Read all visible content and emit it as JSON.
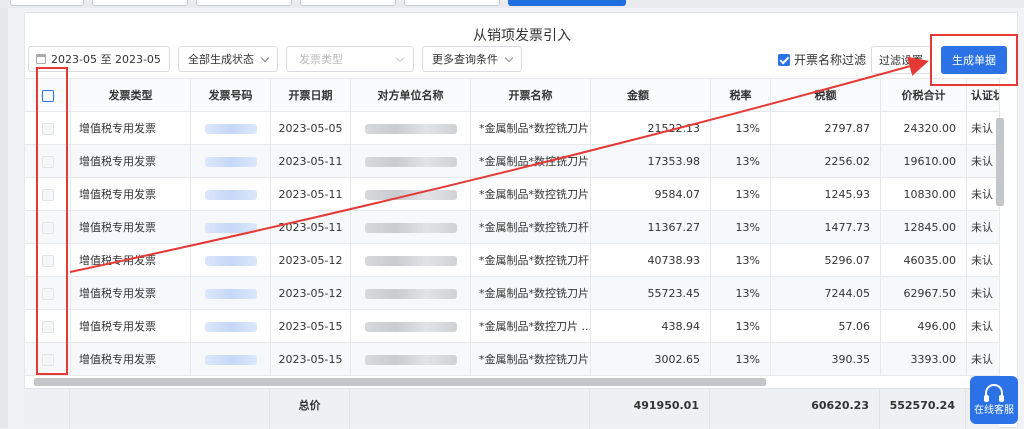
{
  "title": "从销项发票引入",
  "filters": {
    "date_range": "2023-05  至 2023-05",
    "status_select": "全部生成状态",
    "type_placeholder": "发票类型",
    "more_conditions": "更多查询条件",
    "name_filter_checkbox": "开票名称过滤",
    "name_filter_checked": true,
    "filter_settings_button": "过滤设置",
    "generate_button": "生成单据"
  },
  "table": {
    "columns": [
      "发票类型",
      "发票号码",
      "开票日期",
      "对方单位名称",
      "开票名称",
      "金额",
      "税率",
      "税额",
      "价税合计",
      "认证状态"
    ],
    "rows": [
      {
        "type": "增值税专用发票",
        "date": "2023-05-05",
        "item": "*金属制品*数控铣刀片",
        "amount": "21522.13",
        "rate": "13%",
        "tax": "2797.87",
        "total": "24320.00",
        "cert": "未认"
      },
      {
        "type": "增值税专用发票",
        "date": "2023-05-11",
        "item": "*金属制品*数控铣刀片",
        "amount": "17353.98",
        "rate": "13%",
        "tax": "2256.02",
        "total": "19610.00",
        "cert": "未认"
      },
      {
        "type": "增值税专用发票",
        "date": "2023-05-11",
        "item": "*金属制品*数控铣刀片",
        "amount": "9584.07",
        "rate": "13%",
        "tax": "1245.93",
        "total": "10830.00",
        "cert": "未认"
      },
      {
        "type": "增值税专用发票",
        "date": "2023-05-11",
        "item": "*金属制品*数控铣刀杆...",
        "amount": "11367.27",
        "rate": "13%",
        "tax": "1477.73",
        "total": "12845.00",
        "cert": "未认"
      },
      {
        "type": "增值税专用发票",
        "date": "2023-05-12",
        "item": "*金属制品*数控铣刀杆...",
        "amount": "40738.93",
        "rate": "13%",
        "tax": "5296.07",
        "total": "46035.00",
        "cert": "未认"
      },
      {
        "type": "增值税专用发票",
        "date": "2023-05-12",
        "item": "*金属制品*数控铣刀片",
        "amount": "55723.45",
        "rate": "13%",
        "tax": "7244.05",
        "total": "62967.50",
        "cert": "未认"
      },
      {
        "type": "增值税专用发票",
        "date": "2023-05-15",
        "item": "*金属制品*数控刀片 ...",
        "amount": "438.94",
        "rate": "13%",
        "tax": "57.06",
        "total": "496.00",
        "cert": "未认"
      },
      {
        "type": "增值税专用发票",
        "date": "2023-05-15",
        "item": "*金属制品*数控铣刀片",
        "amount": "3002.65",
        "rate": "13%",
        "tax": "390.35",
        "total": "3393.00",
        "cert": "未认"
      }
    ]
  },
  "totals": {
    "label": "总价",
    "amount": "491950.01",
    "tax": "60620.23",
    "total": "552570.24"
  },
  "service_button": "在线客服",
  "colors": {
    "accent": "#2b72e6",
    "annotation": "#e53935"
  }
}
